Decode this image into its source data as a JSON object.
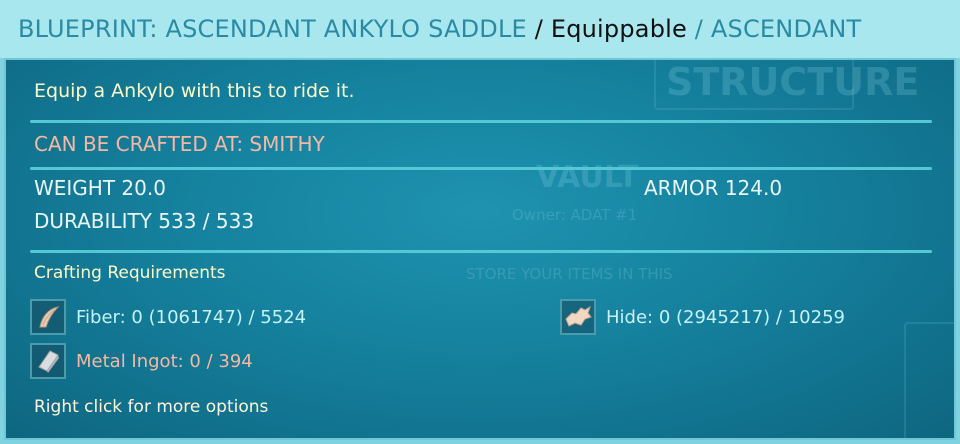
{
  "title": {
    "name": "BLUEPRINT: ASCENDANT ANKYLO SADDLE",
    "sep1": " / ",
    "type": "Equippable",
    "sep2": " / ",
    "tier": "ASCENDANT"
  },
  "tooltip": {
    "description": "Equip a Ankylo with this to ride it.",
    "crafted_at": "CAN BE CRAFTED AT: SMITHY",
    "stats": {
      "weight": "WEIGHT 20.0",
      "armor": "ARMOR 124.0",
      "durability": "DURABILITY 533 / 533"
    },
    "requirements_title": "Crafting Requirements",
    "requirements": [
      {
        "label": "Fiber: 0 (1061747) / 5524",
        "icon": "fiber-icon",
        "status": "ok"
      },
      {
        "label": "Hide: 0 (2945217) / 10259",
        "icon": "hide-icon",
        "status": "ok"
      },
      {
        "label": "Metal Ingot: 0 / 394",
        "icon": "metal-ingot-icon",
        "status": "missing"
      }
    ],
    "hint": "Right click for more options"
  },
  "background": {
    "structure_tab": "STRUCTURE",
    "vault_title": "VAULT",
    "vault_owner": "Owner: ADAT #1",
    "vault_hint": "STORE YOUR ITEMS IN THIS"
  },
  "colors": {
    "title_accent": "#2b8aa3",
    "description": "#fff9c9",
    "crafted_at": "#f4b8a4",
    "missing": "#f4b8a4",
    "ok": "#c5f2f6"
  }
}
